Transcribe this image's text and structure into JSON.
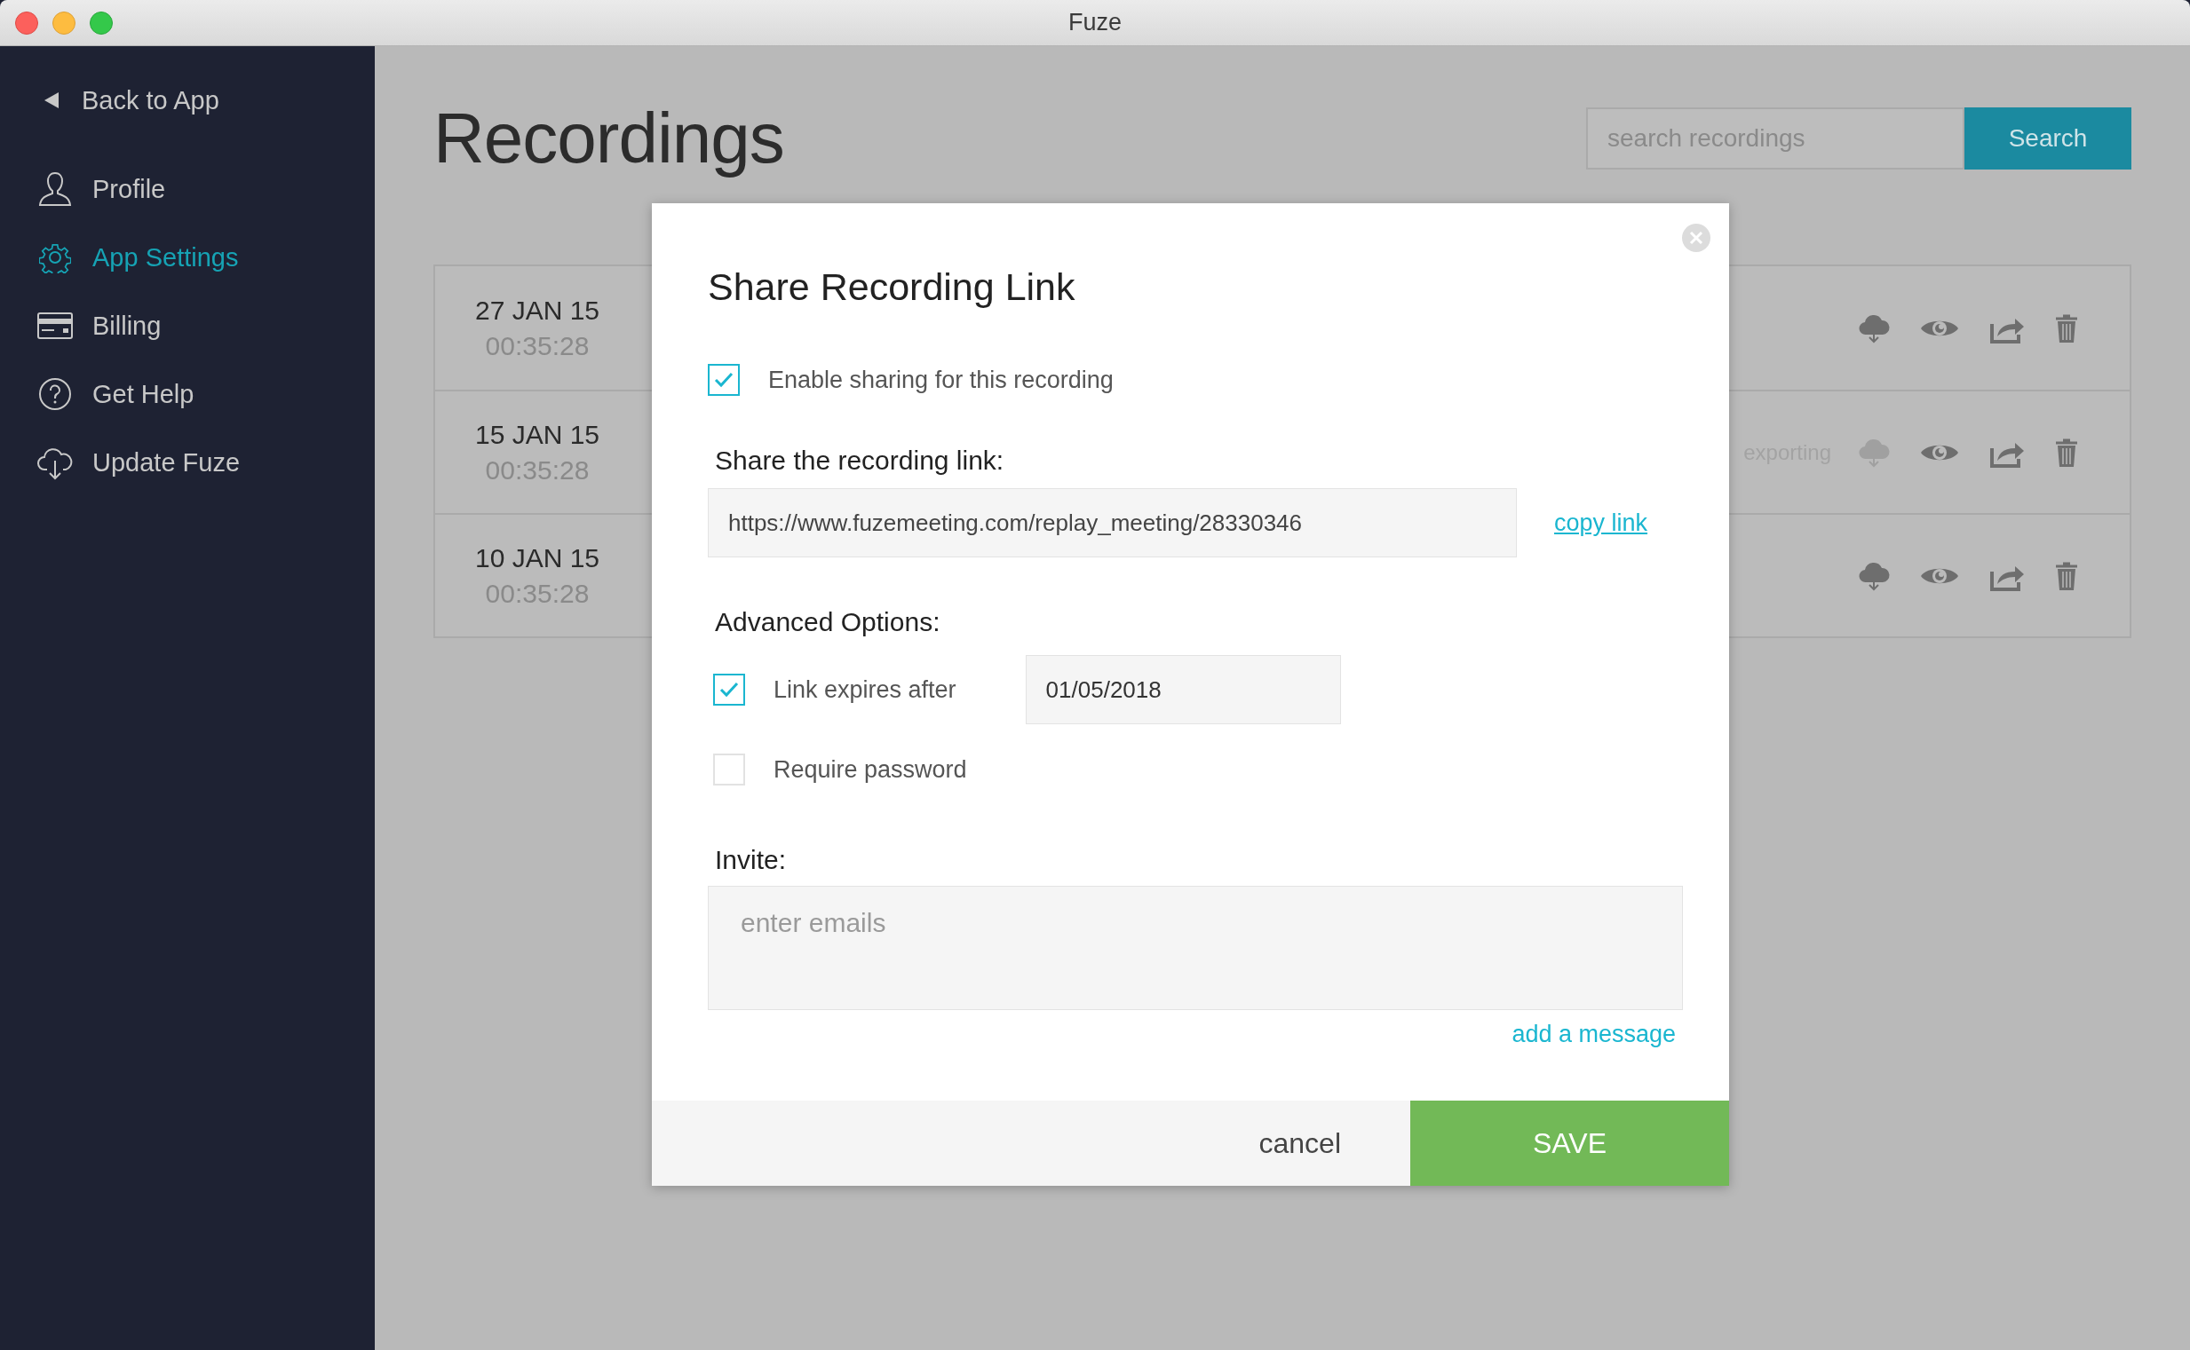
{
  "window": {
    "title": "Fuze"
  },
  "sidebar": {
    "back": {
      "label": "Back to App"
    },
    "items": [
      {
        "kind": "person",
        "label": "Profile",
        "selected": false
      },
      {
        "kind": "gear",
        "label": "App Settings",
        "selected": true
      },
      {
        "kind": "card",
        "label": "Billing",
        "selected": false
      },
      {
        "kind": "help",
        "label": "Get Help",
        "selected": false
      },
      {
        "kind": "cloud",
        "label": "Update Fuze",
        "selected": false
      }
    ]
  },
  "page": {
    "title": "Recordings",
    "search": {
      "placeholder": "search recordings",
      "button": "Search"
    }
  },
  "recordings": [
    {
      "date": "27 JAN 15",
      "duration": "00:35:28"
    },
    {
      "date": "15 JAN 15",
      "duration": "00:35:28",
      "status": "exporting"
    },
    {
      "date": "10 JAN 15",
      "duration": "00:35:28"
    }
  ],
  "dialog": {
    "title": "Share Recording Link",
    "enable_sharing": {
      "label": "Enable sharing for this recording",
      "checked": true
    },
    "link_label": "Share the recording link:",
    "link": {
      "value": "https://www.fuzemeeting.com/replay_meeting/28330346"
    },
    "copy_link": "copy link",
    "advanced_label": "Advanced Options:",
    "options": [
      {
        "label": "Link expires after",
        "checked": true,
        "date": "01/05/2018"
      },
      {
        "label": "Require password",
        "checked": false
      }
    ],
    "invite_label": "Invite:",
    "invite": {
      "placeholder": "enter emails"
    },
    "add_message": "add a message",
    "cancel": "cancel",
    "save": "SAVE"
  }
}
